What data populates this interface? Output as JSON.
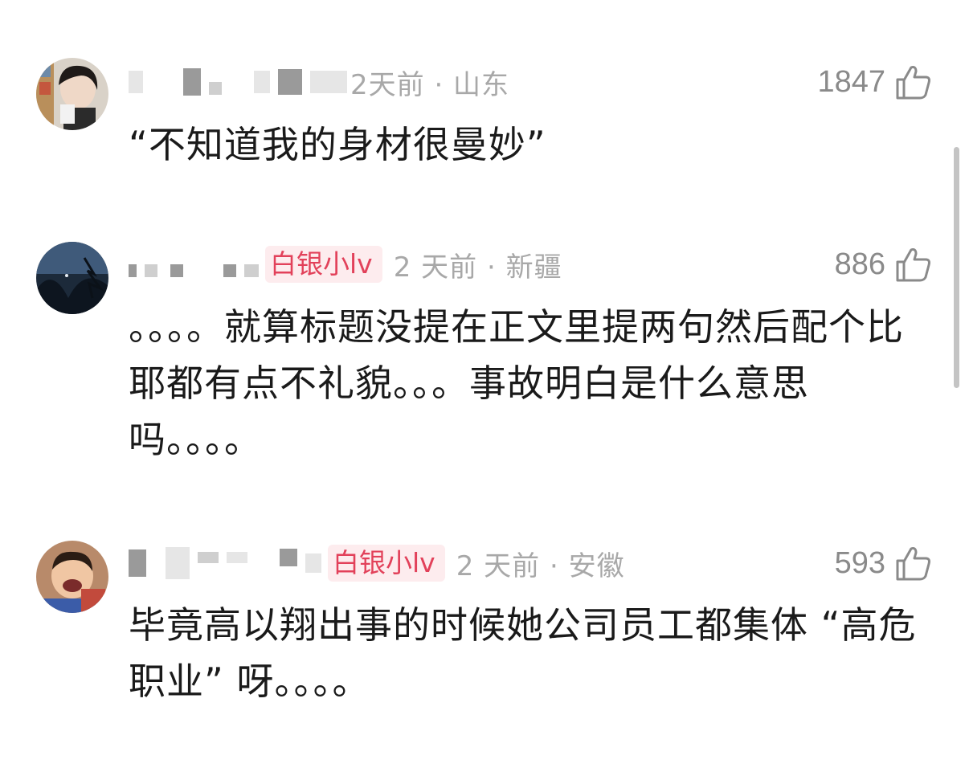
{
  "comments": [
    {
      "meta": "2天前 · 山东",
      "badge": "",
      "likes": "1847",
      "text": "“不知道我的身材很曼妙”"
    },
    {
      "meta": "2 天前 · 新疆",
      "badge": "白银小lv",
      "likes": "886",
      "text": "。。。。就算标题没提在正文里提两句然后配个比耶都有点不礼貌。。。事故明白是什么意思吗。。。。"
    },
    {
      "meta": "2 天前 · 安徽",
      "badge": "白银小lv",
      "likes": "593",
      "text": "毕竟高以翔出事的时候她公司员工都集体 “高危职业” 呀。。。。"
    }
  ],
  "icons": {
    "like": "thumbs-up-icon"
  },
  "colors": {
    "badge_bg": "#fdecee",
    "badge_text": "#e2415a",
    "meta": "#a8a8a8",
    "likes": "#8a8a8a"
  }
}
